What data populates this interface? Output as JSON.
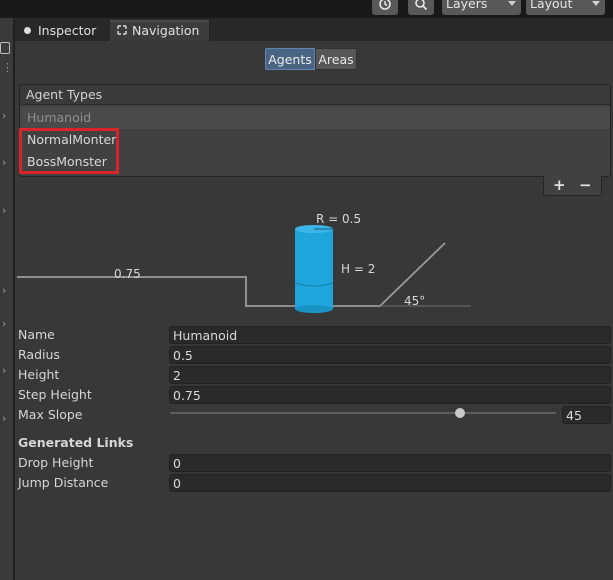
{
  "toolbar": {
    "history_icon": "history-icon",
    "search_icon": "search-icon",
    "layers_label": "Layers",
    "layout_label": "Layout"
  },
  "tabs": [
    {
      "label": "Inspector",
      "icon": "info-icon"
    },
    {
      "label": "Navigation",
      "icon": "navigation-icon"
    }
  ],
  "segmented": {
    "agents": "Agents",
    "areas": "Areas",
    "selected": "Agents"
  },
  "agent_types": {
    "title": "Agent Types",
    "items": [
      "Humanoid",
      "NormalMonter",
      "BossMonster"
    ],
    "add_label": "+",
    "remove_label": "−"
  },
  "diagram": {
    "radius_label": "R = 0.5",
    "height_label": "H = 2",
    "step_label": "0.75",
    "slope_label": "45°",
    "cylinder_color": "#1ea6dc"
  },
  "properties": {
    "name": {
      "label": "Name",
      "value": "Humanoid"
    },
    "radius": {
      "label": "Radius",
      "value": "0.5"
    },
    "height": {
      "label": "Height",
      "value": "2"
    },
    "step_height": {
      "label": "Step Height",
      "value": "0.75"
    },
    "max_slope": {
      "label": "Max Slope",
      "value": "45",
      "slider_fraction": 0.75
    }
  },
  "generated_links": {
    "title": "Generated Links",
    "drop_height": {
      "label": "Drop Height",
      "value": "0"
    },
    "jump_distance": {
      "label": "Jump Distance",
      "value": "0"
    }
  },
  "colors": {
    "accent": "#4a6584",
    "highlight_box": "#d8242a"
  }
}
